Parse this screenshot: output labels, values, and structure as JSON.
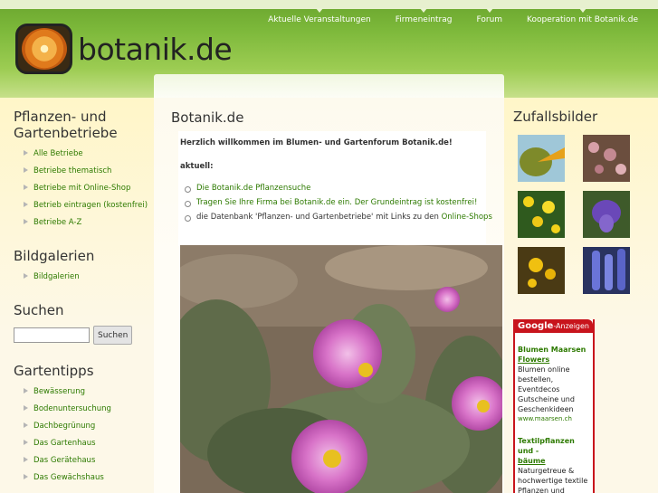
{
  "header": {
    "logo_text": "botanik.de",
    "nav": [
      "Aktuelle Veranstaltungen",
      "Firmeneintrag",
      "Forum",
      "Kooperation mit Botanik.de"
    ]
  },
  "left": {
    "section1": {
      "title": "Pflanzen- und Gartenbetriebe",
      "items": [
        "Alle Betriebe",
        "Betriebe thematisch",
        "Betriebe mit Online-Shop",
        "Betrieb eintragen (kostenfrei)",
        "Betriebe A-Z"
      ]
    },
    "section2": {
      "title": "Bildgalerien",
      "items": [
        "Bildgalerien"
      ]
    },
    "search": {
      "title": "Suchen",
      "button": "Suchen",
      "value": ""
    },
    "section4": {
      "title": "Gartentipps",
      "items": [
        "Bewässerung",
        "Bodenuntersuchung",
        "Dachbegrünung",
        "Das Gartenhaus",
        "Das Gerätehaus",
        "Das Gewächshaus"
      ]
    }
  },
  "main": {
    "title": "Botanik.de",
    "welcome": "Herzlich willkommen im Blumen- und Gartenforum Botanik.de!",
    "aktuell": "aktuell:",
    "news": [
      {
        "link": "Die Botanik.de Pflanzensuche"
      },
      {
        "link": "Tragen Sie Ihre Firma bei Botanik.de ein. Der Grundeintrag ist kostenfrei!"
      },
      {
        "pre": "die Datenbank 'Pflanzen- und Gartenbetriebe' mit Links zu den ",
        "link": "Online-Shops"
      }
    ]
  },
  "right": {
    "title": "Zufallsbilder",
    "ads": {
      "brand": "Google",
      "label": "-Anzeigen",
      "items": [
        {
          "title": "Blumen Maarsen",
          "title_link": "Flowers",
          "desc": "Blumen online bestellen, Eventdecos Gutscheine und Geschenkideen",
          "url": "www.maarsen.ch"
        },
        {
          "title": "Textilpflanzen und -",
          "title_link": "bäume",
          "desc": "Naturgetreue & hochwertige textile Pflanzen und Bäume"
        }
      ]
    }
  },
  "colors": {
    "header_green": "#7cb83a",
    "link_green": "#2d7a00",
    "ads_red": "#c8141c",
    "page_bg": "#fdf8e8"
  }
}
